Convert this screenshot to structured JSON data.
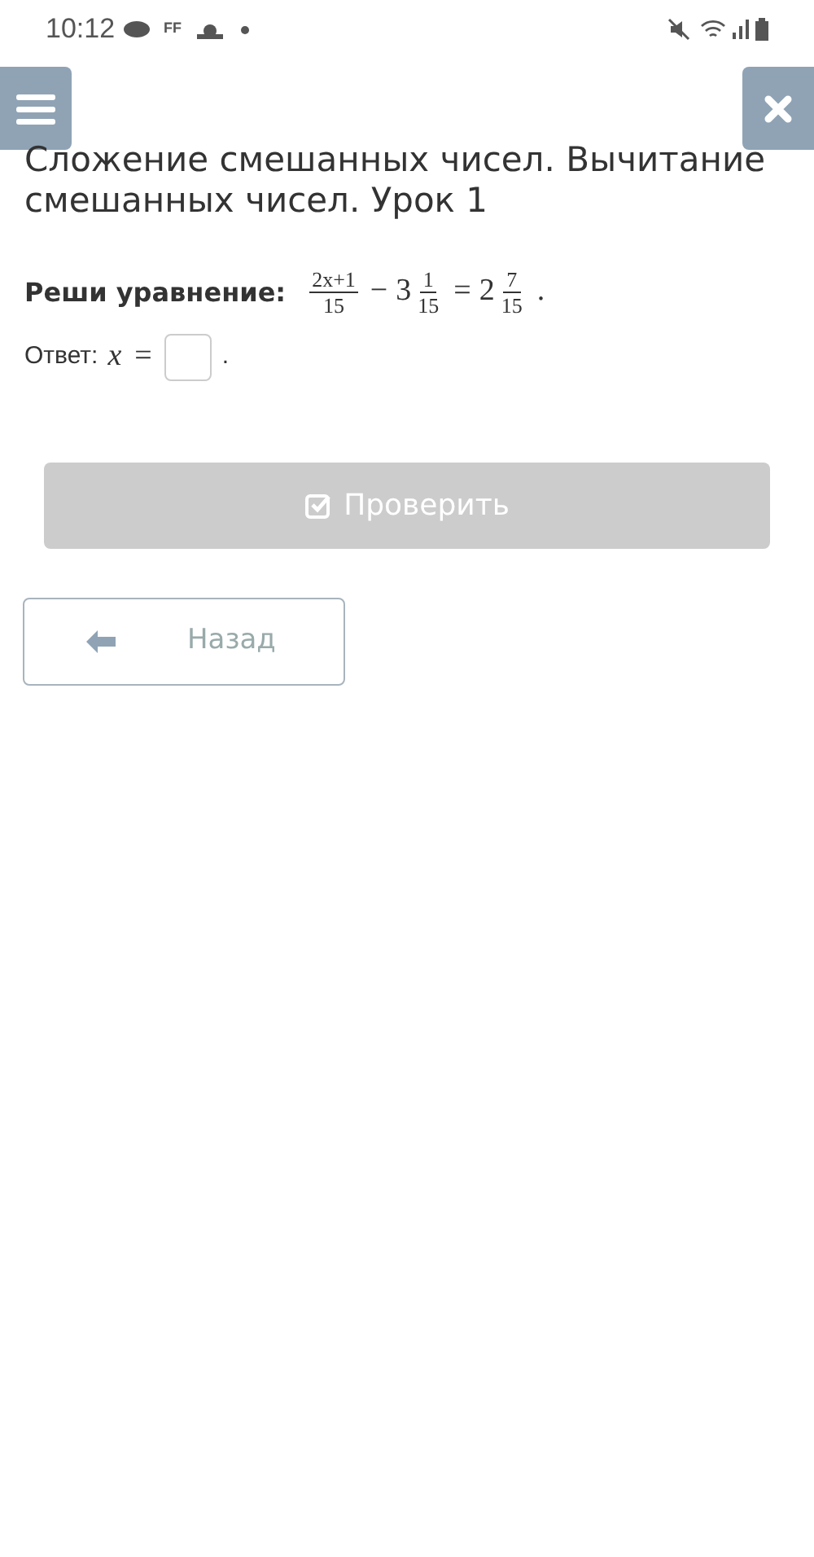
{
  "status_bar": {
    "time": "10:12",
    "notification_text": "FF"
  },
  "title": "Сложение смешанных чисел. Вычитание смешанных чисел. Урок 1",
  "task": {
    "label": "Реши уравнение:",
    "equation": [
      {
        "kind": "fraction",
        "num": "2x+1",
        "den": "15"
      },
      {
        "kind": "op",
        "text": "−"
      },
      {
        "kind": "mixed",
        "whole": "3",
        "num": "1",
        "den": "15"
      },
      {
        "kind": "op",
        "text": "="
      },
      {
        "kind": "mixed",
        "whole": "2",
        "num": "7",
        "den": "15"
      },
      {
        "kind": "op",
        "text": "."
      }
    ]
  },
  "answer": {
    "label": "Ответ:",
    "variable": "x",
    "sign": "=",
    "end": "."
  },
  "check_button": {
    "label": "Проверить",
    "disabled": true
  },
  "back_button": {
    "label": "Назад"
  }
}
